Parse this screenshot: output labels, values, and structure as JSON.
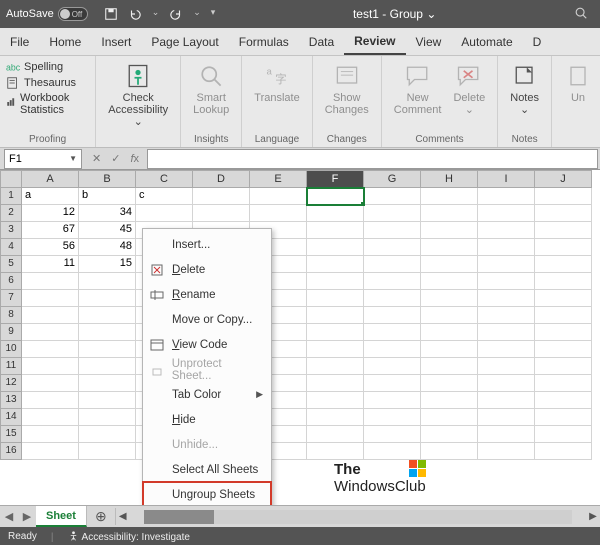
{
  "titlebar": {
    "autosave_label": "AutoSave",
    "autosave_state": "Off",
    "doc_title": "test1 - Group",
    "dropdown_glyph": "⌄"
  },
  "ribbon_tabs": [
    "File",
    "Home",
    "Insert",
    "Page Layout",
    "Formulas",
    "Data",
    "Review",
    "View",
    "Automate",
    "D"
  ],
  "active_tab_index": 6,
  "ribbon": {
    "proofing": {
      "spelling": "Spelling",
      "thesaurus": "Thesaurus",
      "workbook_stats": "Workbook Statistics",
      "group_label": "Proofing"
    },
    "accessibility": {
      "label_l1": "Check",
      "label_l2": "Accessibility"
    },
    "insights": {
      "label_l1": "Smart",
      "label_l2": "Lookup",
      "group_label": "Insights"
    },
    "language": {
      "label": "Translate",
      "group_label": "Language"
    },
    "changes": {
      "label_l1": "Show",
      "label_l2": "Changes",
      "group_label": "Changes"
    },
    "comments": {
      "new_l1": "New",
      "new_l2": "Comment",
      "delete": "Delete",
      "group_label": "Comments"
    },
    "notes": {
      "label": "Notes",
      "group_label": "Notes"
    },
    "extra": "Un"
  },
  "namebox": "F1",
  "columns": [
    "A",
    "B",
    "C",
    "D",
    "E",
    "F",
    "G",
    "H",
    "I",
    "J"
  ],
  "active_col_index": 5,
  "row_count": 16,
  "table": {
    "r1": {
      "A": "a",
      "B": "b",
      "C": "c"
    },
    "r2": {
      "A": "12",
      "B": "34"
    },
    "r3": {
      "A": "67",
      "B": "45"
    },
    "r4": {
      "A": "56",
      "B": "48"
    },
    "r5": {
      "A": "11",
      "B": "15"
    }
  },
  "context_menu": {
    "insert": "Insert...",
    "delete": "Delete",
    "rename": "Rename",
    "move_copy": "Move or Copy...",
    "view_code": "View Code",
    "unprotect": "Unprotect Sheet...",
    "tab_color": "Tab Color",
    "hide": "Hide",
    "unhide": "Unhide...",
    "select_all": "Select All Sheets",
    "ungroup": "Ungroup Sheets"
  },
  "watermark": {
    "line1": "The",
    "line2": "WindowsClub"
  },
  "sheet_tabs": {
    "active": "Sheet"
  },
  "status": {
    "state": "Ready",
    "accessibility": "Accessibility: Investigate"
  }
}
